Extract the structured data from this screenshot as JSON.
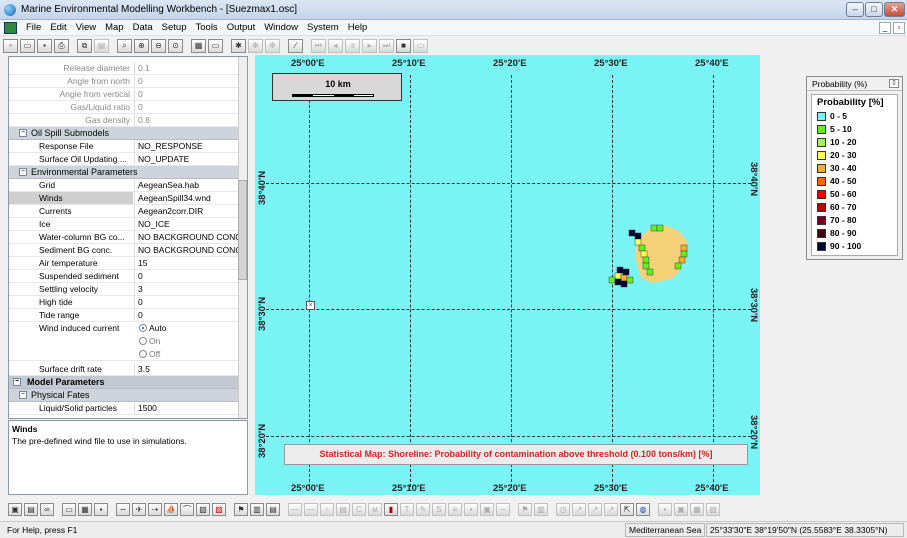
{
  "window": {
    "title": "Marine Environmental Modelling Workbench - [Suezmax1.osc]"
  },
  "menu": [
    "File",
    "Edit",
    "View",
    "Map",
    "Data",
    "Setup",
    "Tools",
    "Output",
    "Window",
    "System",
    "Help"
  ],
  "properties": {
    "release_diameter": {
      "label": "Release diameter",
      "value": "0.1"
    },
    "angle_north": {
      "label": "Angle from north",
      "value": "0"
    },
    "angle_vertical": {
      "label": "Angle from vertical",
      "value": "0"
    },
    "gas_liquid": {
      "label": "Gas/Liquid ratio",
      "value": "0"
    },
    "gas_density": {
      "label": "Gas density",
      "value": "0.8"
    },
    "oil_spill_submodels": "Oil Spill Submodels",
    "response_file": {
      "label": "Response File",
      "value": "NO_RESPONSE"
    },
    "surface_oil": {
      "label": "Surface Oil Updating ...",
      "value": "NO_UPDATE"
    },
    "env_params": "Environmental Parameters",
    "grid": {
      "label": "Grid",
      "value": "AegeanSea.hab"
    },
    "winds": {
      "label": "Winds",
      "value": "AegeanSpill34.wnd"
    },
    "currents": {
      "label": "Currents",
      "value": "Aegean2corr.DIR"
    },
    "ice": {
      "label": "Ice",
      "value": "NO_ICE"
    },
    "water_bg": {
      "label": "Water-column BG co...",
      "value": "NO BACKGROUND CONC"
    },
    "sediment_bg": {
      "label": "Sediment BG conc.",
      "value": "NO BACKGROUND CONC"
    },
    "air_temp": {
      "label": "Air temperature",
      "value": "15"
    },
    "susp_sediment": {
      "label": "Suspended sediment",
      "value": "0"
    },
    "settling": {
      "label": "Settling velocity",
      "value": "3"
    },
    "high_tide": {
      "label": "High tide",
      "value": "0"
    },
    "tide_range": {
      "label": "Tide range",
      "value": "0"
    },
    "wind_current": {
      "label": "Wind induced current",
      "options": [
        "Auto",
        "On",
        "Off"
      ]
    },
    "surface_drift": {
      "label": "Surface drift rate",
      "value": "3.5"
    },
    "model_params": "Model Parameters",
    "physical_fates": "Physical Fates",
    "liquid_solid": {
      "label": "Liquid/Solid particles",
      "value": "1500"
    }
  },
  "description": {
    "title": "Winds",
    "text": "The pre-defined wind file to use in simulations."
  },
  "map": {
    "scale_label": "10 km",
    "lon_labels": [
      "25°00'E",
      "25°10'E",
      "25°20'E",
      "25°30'E",
      "25°40'E"
    ],
    "lat_labels": [
      "38°40'N",
      "38°30'N",
      "38°20'N"
    ],
    "note": "Statistical Map: Shoreline: Probability of contamination above threshold (0.100 tons/km) [%]"
  },
  "legend": {
    "header": "Probability (%)",
    "title": "Probability [%]",
    "items": [
      {
        "label": "0 - 5",
        "color": "#7af3f5"
      },
      {
        "label": "5 - 10",
        "color": "#66ee22"
      },
      {
        "label": "10 - 20",
        "color": "#a8f060"
      },
      {
        "label": "20 - 30",
        "color": "#ffff55"
      },
      {
        "label": "30 - 40",
        "color": "#f0b030"
      },
      {
        "label": "40 - 50",
        "color": "#ff6600"
      },
      {
        "label": "50 - 60",
        "color": "#ee0000"
      },
      {
        "label": "60 - 70",
        "color": "#bb0000"
      },
      {
        "label": "70 - 80",
        "color": "#770022"
      },
      {
        "label": "80 - 90",
        "color": "#440011"
      },
      {
        "label": "90 - 100",
        "color": "#000033"
      }
    ]
  },
  "status": {
    "help": "For Help, press F1",
    "region": "Mediterranean Sea",
    "coords": "25°33'30\"E  38°19'50\"N  (25.5583°E  38.3305°N)"
  }
}
